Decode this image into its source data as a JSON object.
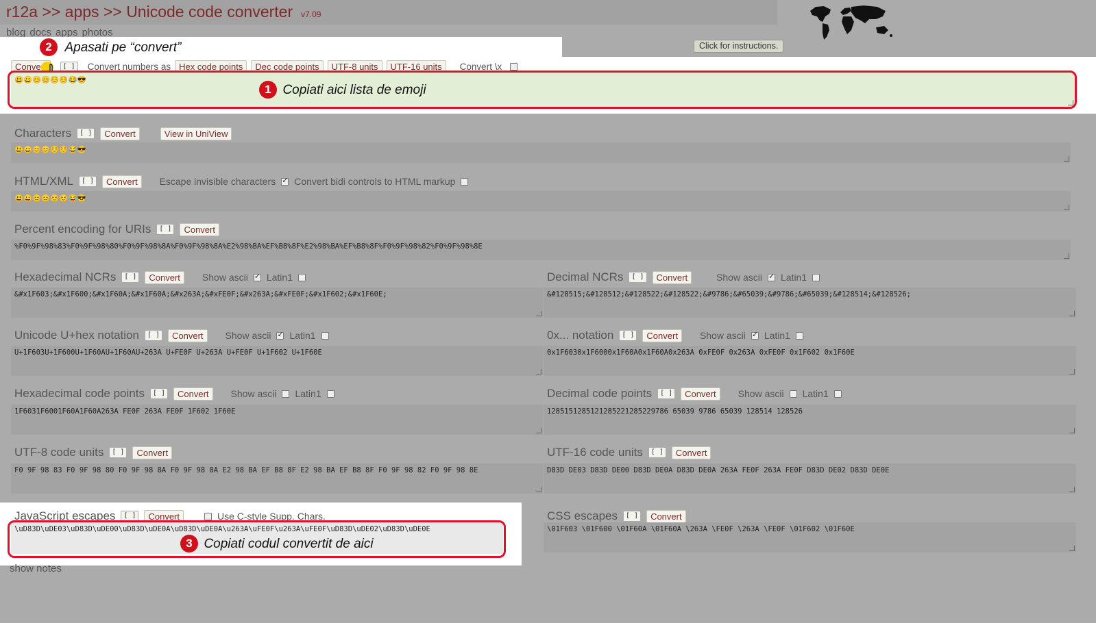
{
  "header": {
    "title": "r12a >> apps >> Unicode code converter",
    "version": "v7.09",
    "nav": [
      "blog",
      "docs",
      "apps",
      "photos"
    ],
    "instructions_button": "Click for instructions."
  },
  "input": {
    "convert_button": "Convert",
    "bracket_button": "[ ]",
    "convert_numbers_as_label": "Convert numbers as",
    "options": [
      "Hex code points",
      "Dec code points",
      "UTF-8 units",
      "UTF-16 units"
    ],
    "convert_x_label": "Convert \\x",
    "value": "😃😀😊😊☺️☺️😂😎"
  },
  "annotations": {
    "step1_num": "1",
    "step1_text": "Copiati aici lista de emoji",
    "step2_num": "2",
    "step2_text": "Apasati pe “convert”",
    "step3_num": "3",
    "step3_text": "Copiati codul convertit de aici"
  },
  "sections": {
    "characters": {
      "title": "Characters",
      "bracket": "[ ]",
      "convert": "Convert",
      "view": "View in UniView",
      "value": "😃😀😊😊☺️☺️😂😎"
    },
    "html": {
      "title": "HTML/XML",
      "bracket": "[ ]",
      "convert": "Convert",
      "escape_label": "Escape invisible characters",
      "bidi_label": "Convert bidi controls to HTML markup",
      "value": "😃😀😊😊☺️☺️😂😎"
    },
    "percent": {
      "title": "Percent encoding for URIs",
      "bracket": "[ ]",
      "convert": "Convert",
      "value": "%F0%9F%98%83%F0%9F%98%80%F0%9F%98%8A%F0%9F%98%8A%E2%98%BA%EF%B8%8F%E2%98%BA%EF%B8%8F%F0%9F%98%82%F0%9F%98%8E"
    },
    "hexncr": {
      "title": "Hexadecimal NCRs",
      "bracket": "[ ]",
      "convert": "Convert",
      "show_ascii": "Show ascii",
      "latin1": "Latin1",
      "value": "&#x1F603;&#x1F600;&#x1F60A;&#x1F60A;&#x263A;&#xFE0F;&#x263A;&#xFE0F;&#x1F602;&#x1F60E;"
    },
    "decncr": {
      "title": "Decimal NCRs",
      "bracket": "[ ]",
      "convert": "Convert",
      "show_ascii": "Show ascii",
      "latin1": "Latin1",
      "value": "&#128515;&#128512;&#128522;&#128522;&#9786;&#65039;&#9786;&#65039;&#128514;&#128526;"
    },
    "uplus": {
      "title": "Unicode U+hex notation",
      "bracket": "[ ]",
      "convert": "Convert",
      "show_ascii": "Show ascii",
      "latin1": "Latin1",
      "value": "U+1F603U+1F600U+1F60AU+1F60AU+263A U+FE0F U+263A U+FE0F U+1F602 U+1F60E"
    },
    "zerox": {
      "title": "0x... notation",
      "bracket": "[ ]",
      "convert": "Convert",
      "show_ascii": "Show ascii",
      "latin1": "Latin1",
      "value": "0x1F6030x1F6000x1F60A0x1F60A0x263A 0xFE0F 0x263A 0xFE0F 0x1F602 0x1F60E"
    },
    "hexcp": {
      "title": "Hexadecimal code points",
      "bracket": "[ ]",
      "convert": "Convert",
      "show_ascii": "Show ascii",
      "latin1": "Latin1",
      "value": "1F6031F6001F60A1F60A263A FE0F 263A FE0F 1F602 1F60E"
    },
    "deccp": {
      "title": "Decimal code points",
      "bracket": "[ ]",
      "convert": "Convert",
      "show_ascii": "Show ascii",
      "latin1": "Latin1",
      "value": "1285151285121285221285229786 65039 9786 65039 128514 128526"
    },
    "utf8": {
      "title": "UTF-8 code units",
      "bracket": "[ ]",
      "convert": "Convert",
      "value": "F0 9F 98 83 F0 9F 98 80 F0 9F 98 8A F0 9F 98 8A E2 98 BA EF B8 8F E2 98 BA EF B8 8F F0 9F 98 82 F0 9F 98 8E"
    },
    "utf16": {
      "title": "UTF-16 code units",
      "bracket": "[ ]",
      "convert": "Convert",
      "value": "D83D DE03 D83D DE00 D83D DE0A D83D DE0A 263A FE0F 263A FE0F D83D DE02 D83D DE0E"
    },
    "js": {
      "title": "JavaScript escapes",
      "bracket": "[ ]",
      "convert": "Convert",
      "cstyle_label": "Use C-style Supp. Chars.",
      "value": "\\uD83D\\uDE03\\uD83D\\uDE00\\uD83D\\uDE0A\\uD83D\\uDE0A\\u263A\\uFE0F\\u263A\\uFE0F\\uD83D\\uDE02\\uD83D\\uDE0E"
    },
    "css": {
      "title": "CSS escapes",
      "bracket": "[ ]",
      "convert": "Convert",
      "value": "\\01F603 \\01F600 \\01F60A \\01F60A \\263A \\FE0F \\263A \\FE0F \\01F602 \\01F60E"
    }
  },
  "footer": {
    "show_notes": "show notes"
  }
}
